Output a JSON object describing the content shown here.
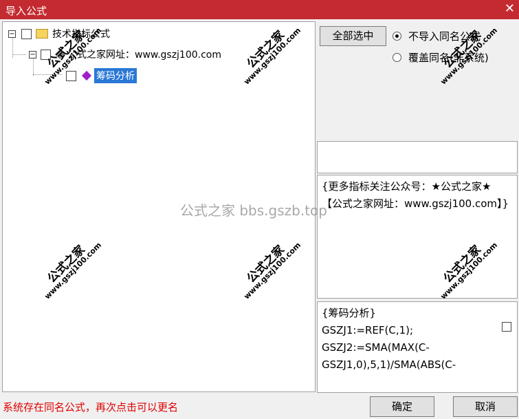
{
  "window": {
    "title": "导入公式",
    "close_glyph": "✕"
  },
  "tree": {
    "root_label": "技术指标公式",
    "child_label": "公式之家网址：www.gszj100.com",
    "leaf_label": "筹码分析",
    "expand_glyph": "−"
  },
  "actions": {
    "select_all": "全部选中",
    "radio_no_import": "不导入同名公式",
    "radio_overwrite": "覆盖同名(非系统)",
    "confirm": "确定",
    "cancel": "取消"
  },
  "info_text": "{更多指标关注公众号：★公式之家★ 【公式之家网址：www.gszj100.com】}",
  "code_lines": [
    "{筹码分析}",
    "GSZJ1:=REF(C,1);",
    "GSZJ2:=SMA(MAX(C-",
    "GSZJ1,0),5,1)/SMA(ABS(C-"
  ],
  "status_text": "系统存在同名公式，再次点击可以更名",
  "watermark": {
    "center": "公式之家 bbs.gszb.top",
    "small_cn": "公式之家",
    "small_url": "www.gszj100.com"
  },
  "colors": {
    "titlebar": "#c42b30",
    "selection": "#2a78d6",
    "status": "#e00000"
  }
}
